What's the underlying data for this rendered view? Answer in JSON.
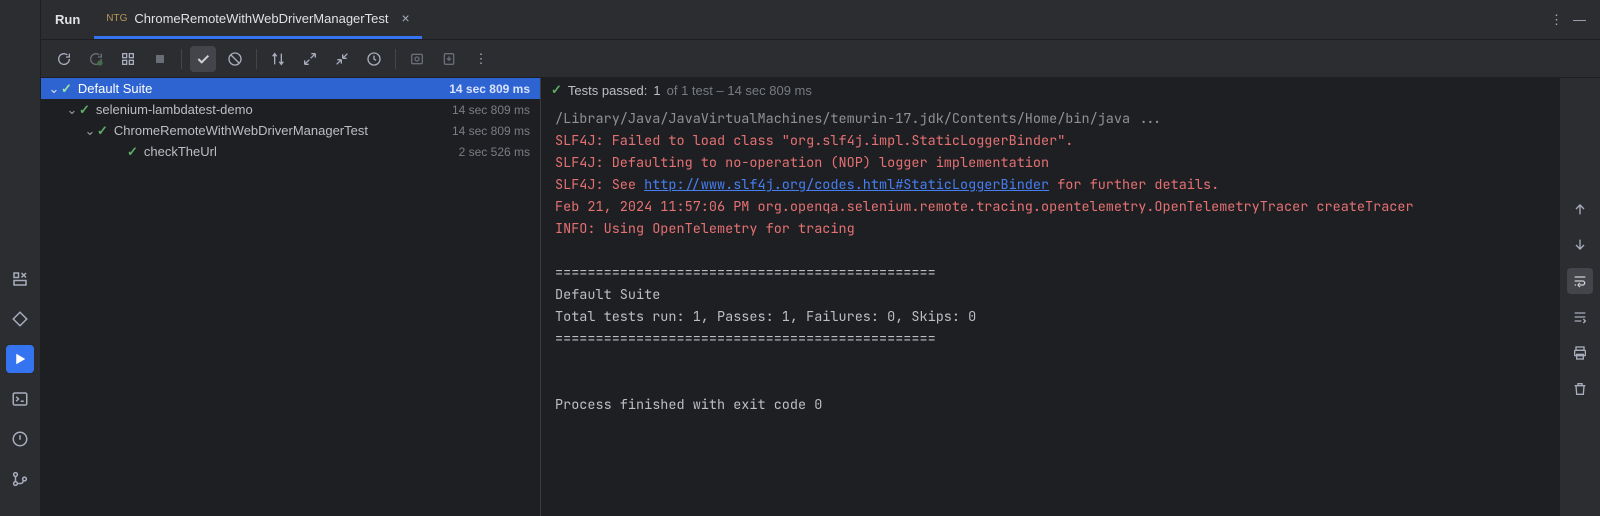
{
  "tabs": {
    "run_label": "Run",
    "file_label": "ChromeRemoteWithWebDriverManagerTest",
    "file_icon": "NTG"
  },
  "tree": {
    "root": {
      "label": "Default Suite",
      "time": "14 sec 809 ms"
    },
    "project": {
      "label": "selenium-lambdatest-demo",
      "time": "14 sec 809 ms"
    },
    "class": {
      "label": "ChromeRemoteWithWebDriverManagerTest",
      "time": "14 sec 809 ms"
    },
    "method": {
      "label": "checkTheUrl",
      "time": "2 sec 526 ms"
    }
  },
  "console_header": {
    "passed_prefix": "Tests passed:",
    "passed_count": "1",
    "rest": "of 1 test – 14 sec 809 ms"
  },
  "console": {
    "l1": "/Library/Java/JavaVirtualMachines/temurin-17.jdk/Contents/Home/bin/java ...",
    "l2": "SLF4J: Failed to load class \"org.slf4j.impl.StaticLoggerBinder\".",
    "l3": "SLF4J: Defaulting to no-operation (NOP) logger implementation",
    "l4a": "SLF4J: See ",
    "l4link": "http://www.slf4j.org/codes.html#StaticLoggerBinder",
    "l4b": " for further details.",
    "l5": "Feb 21, 2024 11:57:06 PM org.openqa.selenium.remote.tracing.opentelemetry.OpenTelemetryTracer createTracer",
    "l6": "INFO: Using OpenTelemetry for tracing",
    "l8": "===============================================",
    "l9": "Default Suite",
    "l10": "Total tests run: 1, Passes: 1, Failures: 0, Skips: 0",
    "l11": "===============================================",
    "l13": "Process finished with exit code 0"
  }
}
